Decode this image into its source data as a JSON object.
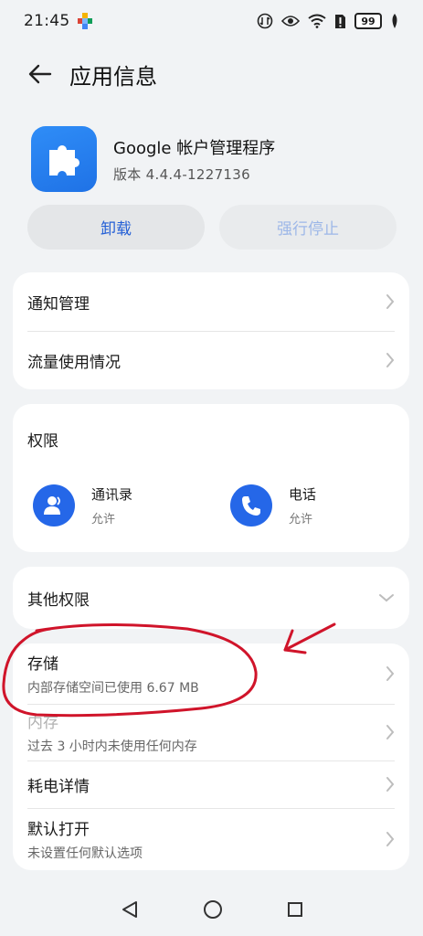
{
  "status_bar": {
    "time": "21:45",
    "battery": "99"
  },
  "header": {
    "title": "应用信息"
  },
  "app": {
    "name": "Google 帐户管理程序",
    "version": "版本 4.4.4-1227136"
  },
  "actions": {
    "uninstall": "卸载",
    "force_stop": "强行停止"
  },
  "general": {
    "notifications": "通知管理",
    "data_usage": "流量使用情况"
  },
  "permissions": {
    "title": "权限",
    "items": [
      {
        "name": "通讯录",
        "state": "允许",
        "icon": "contacts-icon"
      },
      {
        "name": "电话",
        "state": "允许",
        "icon": "phone-icon"
      }
    ]
  },
  "other_permissions": {
    "title": "其他权限"
  },
  "details": {
    "storage_title": "存储",
    "storage_sub": "内部存储空间已使用 6.67 MB",
    "memory_title": "内存",
    "memory_sub": "过去 3 小时内未使用任何内存",
    "battery_title": "耗电详情",
    "default_title": "默认打开",
    "default_sub": "未设置任何默认选项"
  },
  "colors": {
    "accent": "#2560d6",
    "annotation": "#d0142a"
  }
}
